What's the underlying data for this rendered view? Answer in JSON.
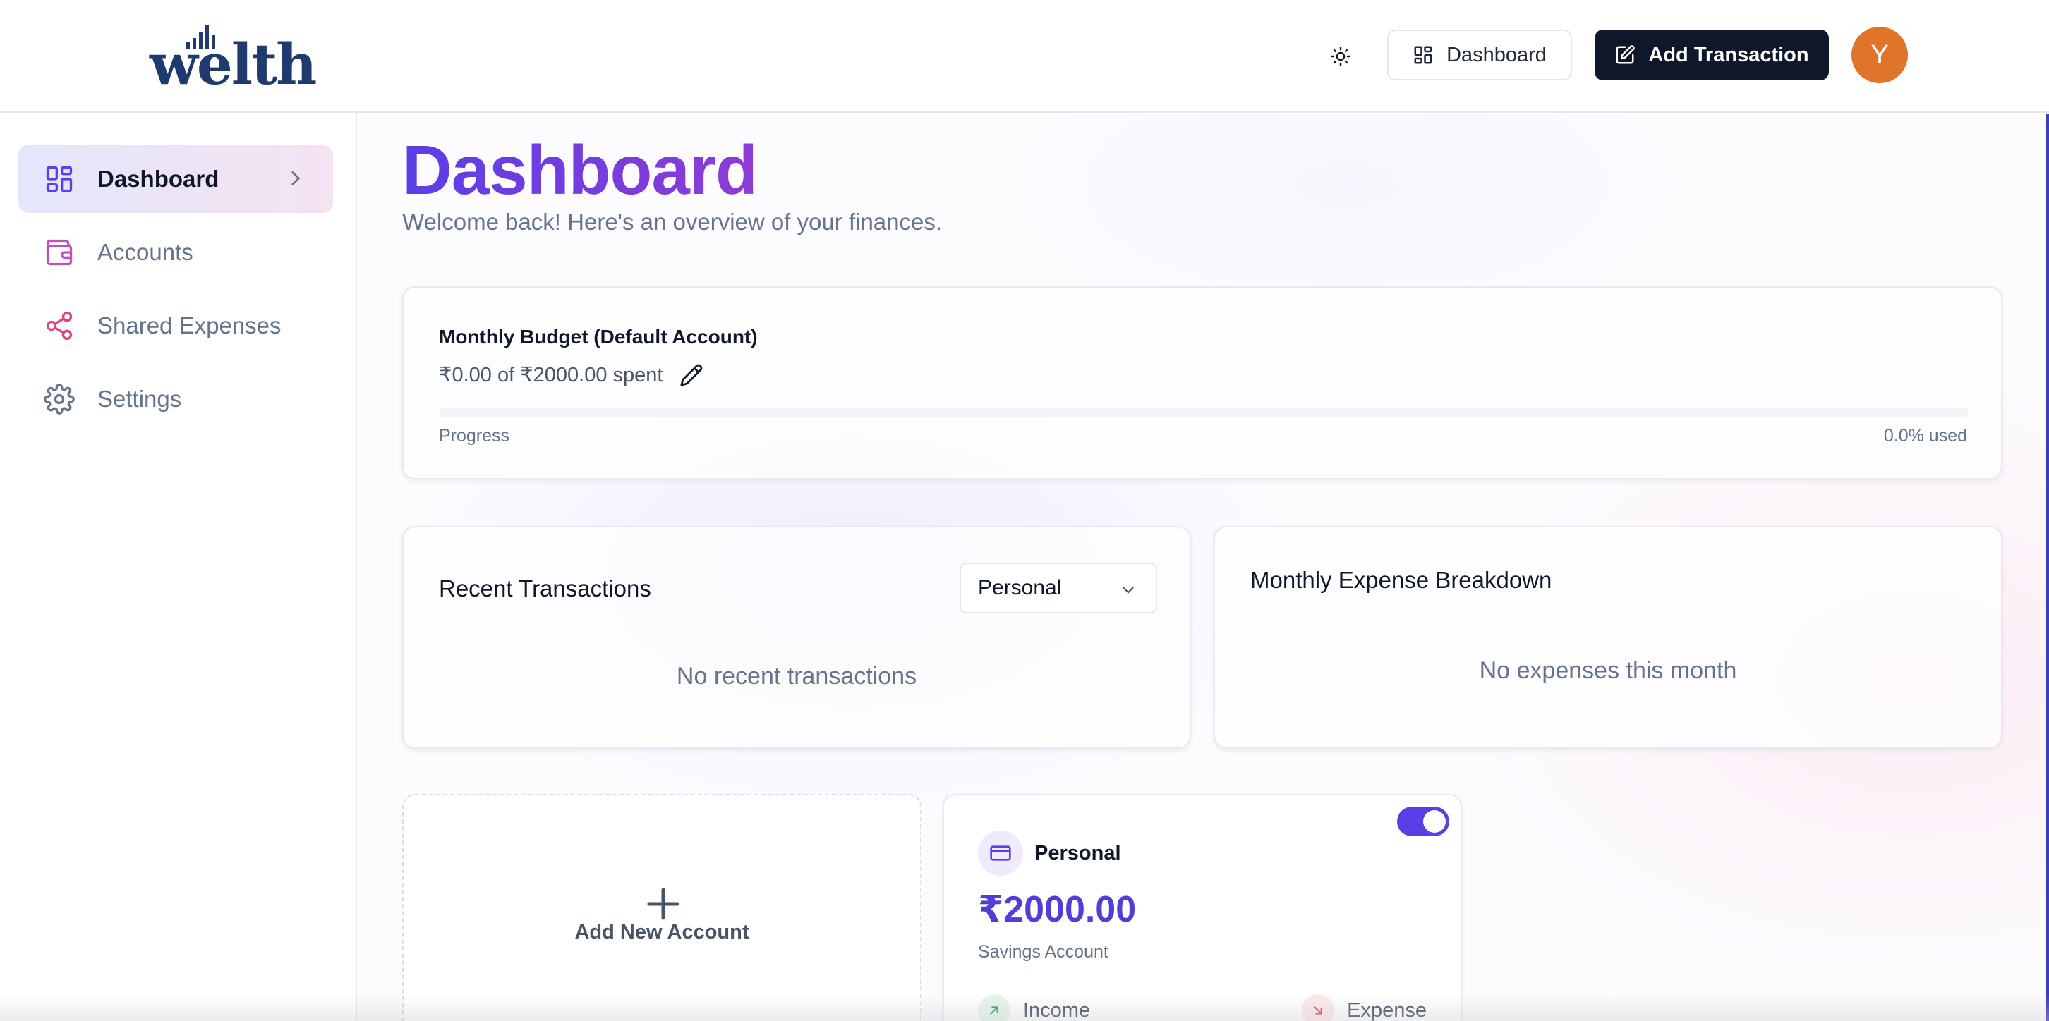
{
  "brand": {
    "logo_text": "welth",
    "accent": "#5b3fe6",
    "logo_color": "#1e3a6e"
  },
  "header": {
    "theme_icon": "sun-icon",
    "dashboard_label": "Dashboard",
    "add_transaction_label": "Add Transaction",
    "avatar_initial": "Y",
    "avatar_color": "#e07529"
  },
  "sidebar": {
    "items": [
      {
        "label": "Dashboard",
        "icon": "layout-dashboard-icon",
        "active": true
      },
      {
        "label": "Accounts",
        "icon": "wallet-icon",
        "active": false
      },
      {
        "label": "Shared Expenses",
        "icon": "share-icon",
        "active": false
      },
      {
        "label": "Settings",
        "icon": "gear-icon",
        "active": false
      }
    ]
  },
  "main": {
    "title": "Dashboard",
    "subtitle": "Welcome back! Here's an overview of your finances.",
    "budget": {
      "title": "Monthly Budget (Default Account)",
      "spent_text": "₹0.00 of ₹2000.00 spent",
      "progress_label": "Progress",
      "progress_used": "0.0% used",
      "progress_fraction": 0.0
    },
    "transactions": {
      "title": "Recent Transactions",
      "selected_account": "Personal",
      "empty_text": "No recent transactions"
    },
    "expenses": {
      "title": "Monthly Expense Breakdown",
      "empty_text": "No expenses this month"
    },
    "add_account": {
      "label": "Add New Account"
    },
    "account": {
      "name": "Personal",
      "balance": "₹2000.00",
      "type": "Savings Account",
      "default_enabled": true,
      "income_label": "Income",
      "expense_label": "Expense"
    }
  }
}
